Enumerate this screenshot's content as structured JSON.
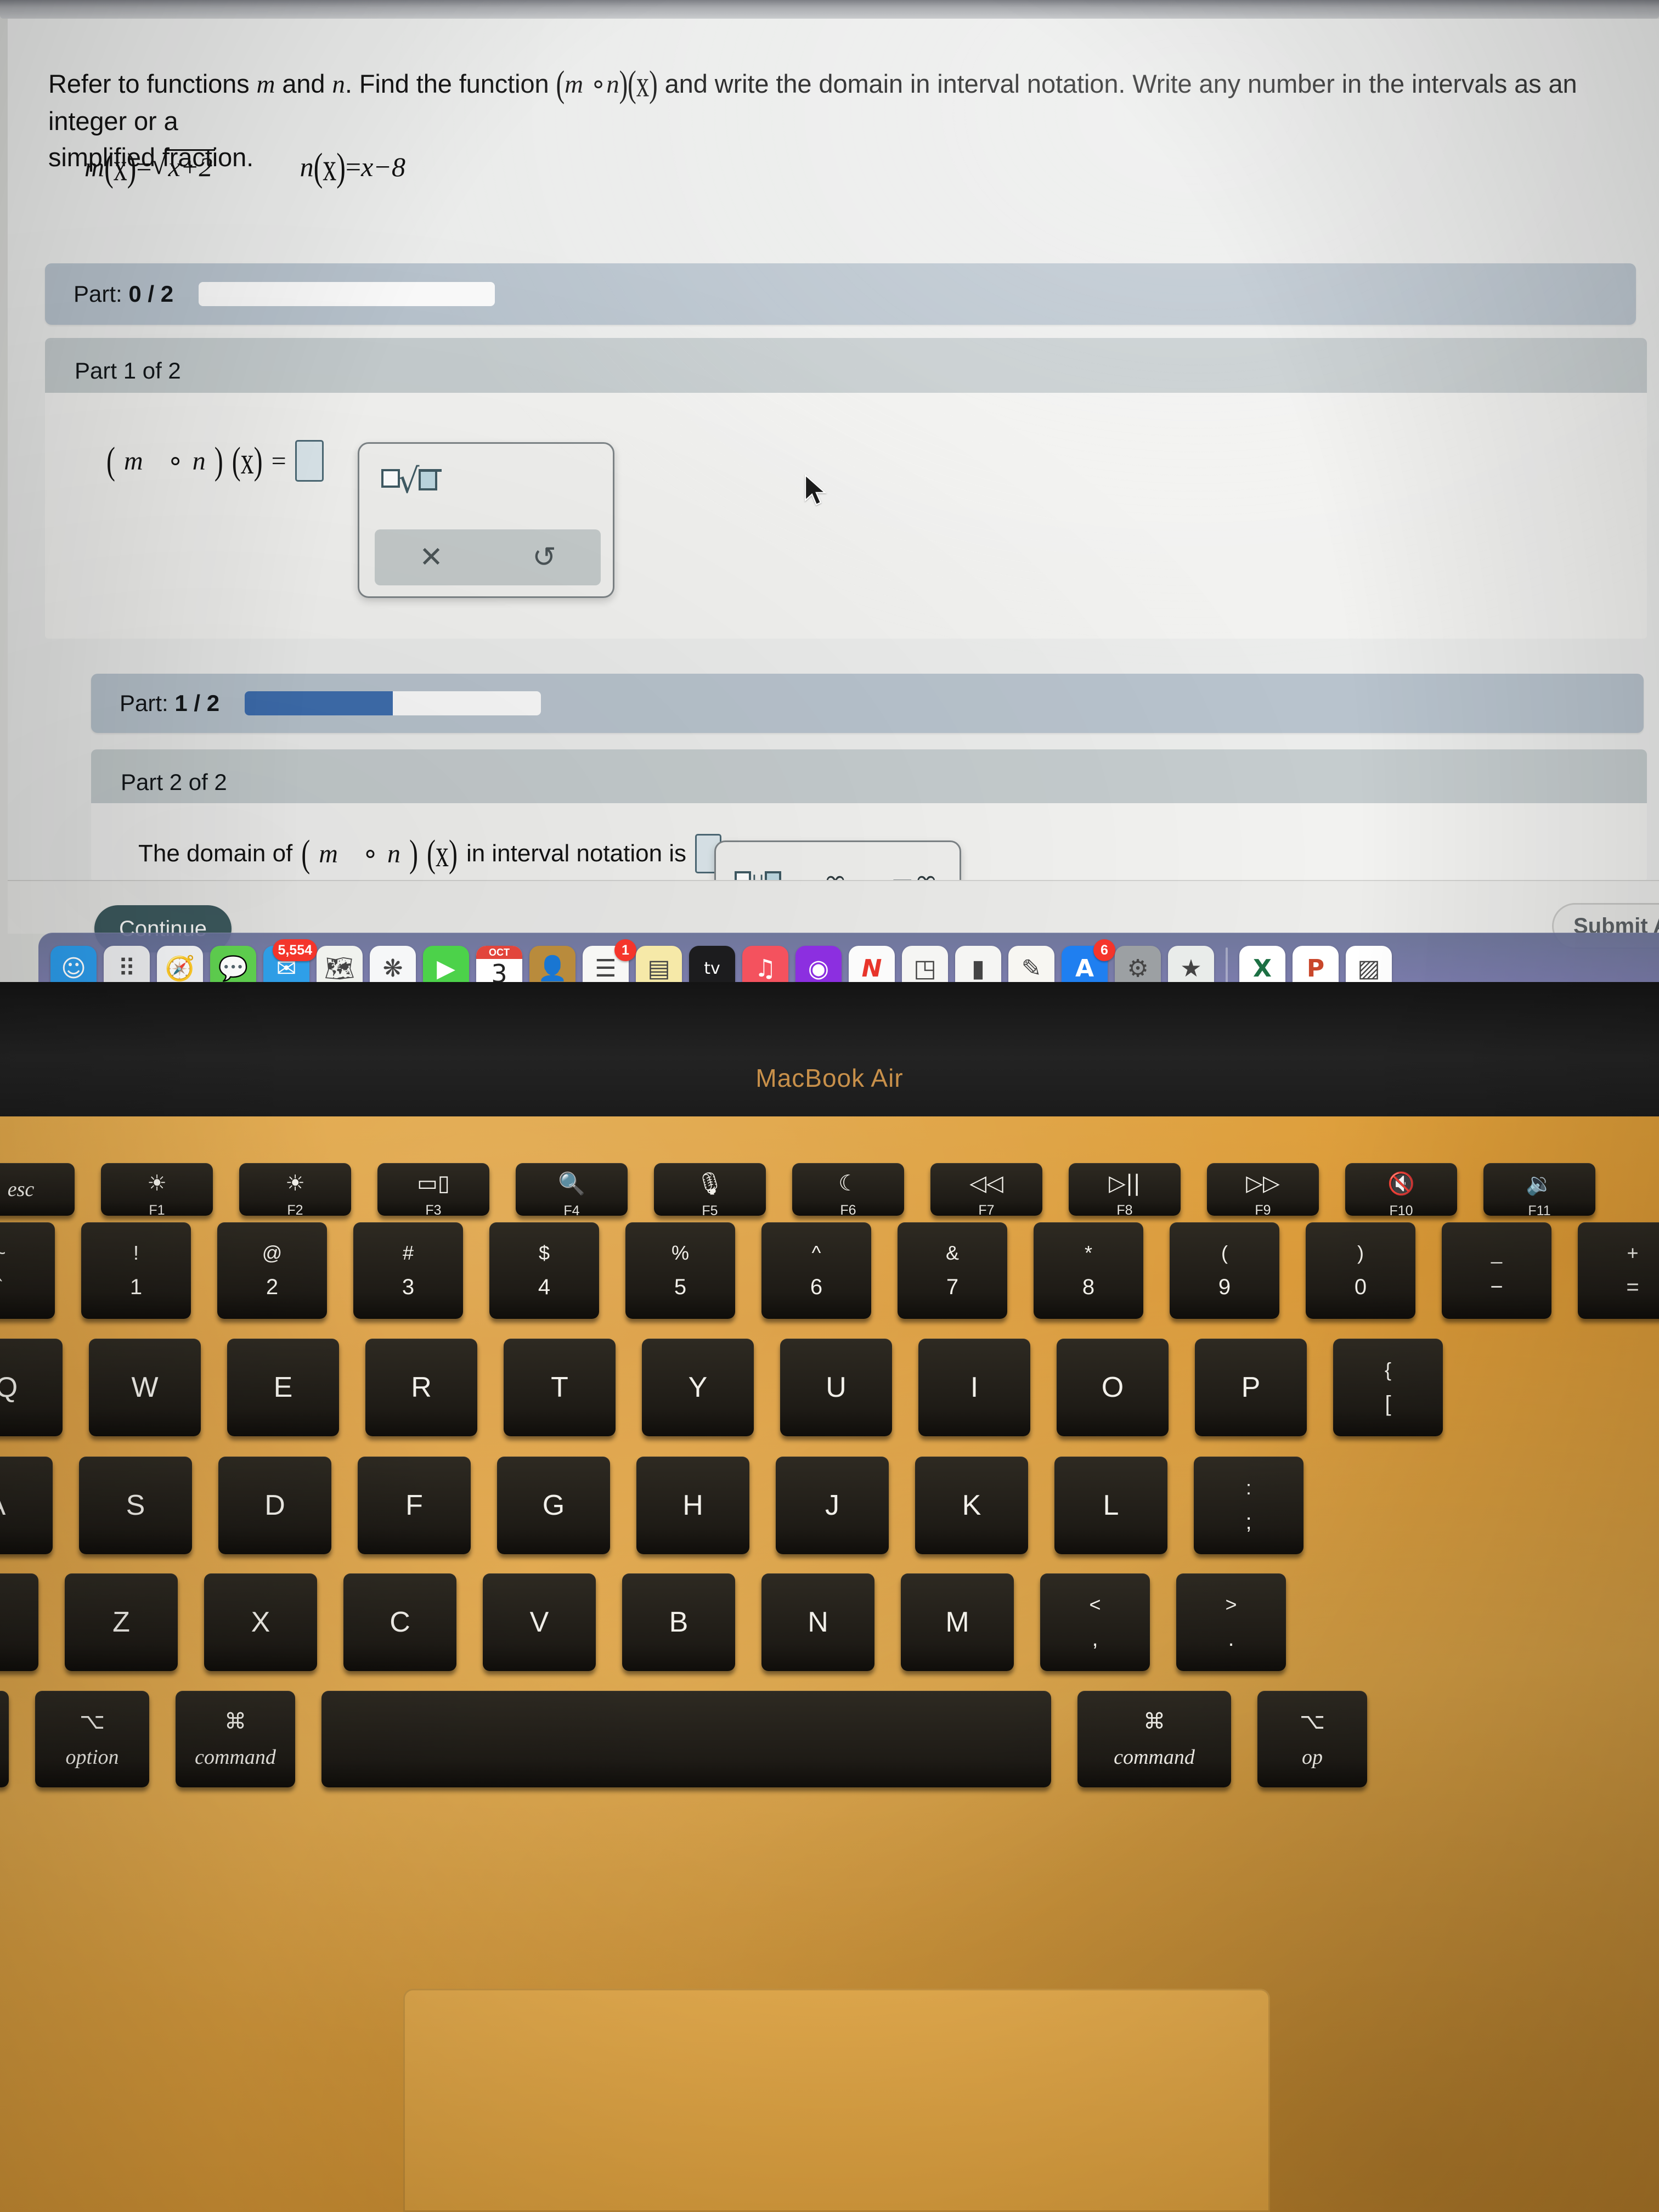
{
  "webpage": {
    "question": {
      "line1_pre": "Refer to functions ",
      "var_m": "m",
      "line1_mid": " and ",
      "var_n": "n",
      "line1_post": ". Find the function ",
      "comp_open": "(",
      "comp_m": "m",
      "comp_ring": "∘",
      "comp_n": "n",
      "comp_close": ")",
      "comp_x": "(x)",
      "line1_tail": " and write the domain in interval notation. Write any number in the intervals as an integer or a",
      "line2": "simplified fraction."
    },
    "definitions": {
      "m_label": "m",
      "m_arg": "(x)",
      "m_equals": "=",
      "m_radicand": "x+2",
      "n_label": "n",
      "n_arg": "(x)",
      "n_equals": "=",
      "n_expr": "x−8"
    },
    "part_progress_1": {
      "label": "Part:",
      "value": "0 / 2",
      "percent": 0
    },
    "part_progress_2": {
      "label": "Part:",
      "value": "1 / 2",
      "percent": 50
    },
    "part1": {
      "title": "Part 1 of 2",
      "prompt_open": "(",
      "prompt_m": "m",
      "prompt_ring": "∘",
      "prompt_n": "n",
      "prompt_close": ")",
      "prompt_x": "(x)",
      "prompt_eq": "=",
      "answer_value": ""
    },
    "part2": {
      "title": "Part 2 of 2",
      "text_pre": "The domain of ",
      "comp_open": "(",
      "comp_m": "m",
      "comp_ring": "∘",
      "comp_n": "n",
      "comp_close": ")",
      "comp_x": "(x)",
      "text_post": " in interval notation is",
      "period": ".",
      "answer_value": ""
    },
    "math_palette_1": {
      "nth_root_icon": "nth-root-icon",
      "clear_icon": "✕",
      "undo_icon": "↺"
    },
    "math_palette_2": {
      "union_icon": "□∪□",
      "infinity_icon": "∞",
      "neg_infinity_icon": "−∞"
    },
    "buttons": {
      "continue": "Continue",
      "submit": "Submit Ass"
    }
  },
  "dock": {
    "items": [
      {
        "name": "finder",
        "glyph": "☺",
        "bg": "#2b9ae8",
        "badge": null
      },
      {
        "name": "launchpad",
        "glyph": "⠿",
        "bg": "#e9eaec",
        "badge": null
      },
      {
        "name": "safari",
        "glyph": "🧭",
        "bg": "#f2f3f5",
        "badge": null
      },
      {
        "name": "messages",
        "glyph": "💬",
        "bg": "#5fd04f",
        "badge": null
      },
      {
        "name": "mail",
        "glyph": "✉",
        "bg": "#2f9fe8",
        "badge": "5,554"
      },
      {
        "name": "maps",
        "glyph": "🗺",
        "bg": "#f0f2ee",
        "badge": null
      },
      {
        "name": "photos",
        "glyph": "❋",
        "bg": "#f6f7f8",
        "badge": null
      },
      {
        "name": "facetime",
        "glyph": "▶",
        "bg": "#4cd24a",
        "badge": null
      },
      {
        "name": "calendar",
        "glyph": "3",
        "bg": "#ffffff",
        "badge": null,
        "top": "OCT"
      },
      {
        "name": "contacts",
        "glyph": "👤",
        "bg": "#b98b3c",
        "badge": null
      },
      {
        "name": "reminders",
        "glyph": "☰",
        "bg": "#f7f7f5",
        "badge": "1"
      },
      {
        "name": "notes",
        "glyph": "▤",
        "bg": "#f6e9a8",
        "badge": null
      },
      {
        "name": "apple-tv",
        "glyph": "tv",
        "bg": "#1c1c1e",
        "badge": null
      },
      {
        "name": "music",
        "glyph": "♫",
        "bg": "#f4525e",
        "badge": null
      },
      {
        "name": "podcasts",
        "glyph": "◉",
        "bg": "#8c2fe0",
        "badge": null
      },
      {
        "name": "news",
        "glyph": "N",
        "bg": "#fbfbfb",
        "badge": null
      },
      {
        "name": "keynote",
        "glyph": "◳",
        "bg": "#f5f5f3",
        "badge": null
      },
      {
        "name": "numbers",
        "glyph": "▮",
        "bg": "#f5f5f3",
        "badge": null
      },
      {
        "name": "pages",
        "glyph": "✎",
        "bg": "#f7f6f2",
        "badge": null
      },
      {
        "name": "app-store",
        "glyph": "A",
        "bg": "#1f7ff0",
        "badge": "6"
      },
      {
        "name": "system-settings",
        "glyph": "⚙",
        "bg": "#9ca0a3",
        "badge": null
      },
      {
        "name": "photo-booth",
        "glyph": "★",
        "bg": "#e9ecea",
        "badge": null
      },
      {
        "name": "separator",
        "glyph": "",
        "bg": "",
        "badge": null
      },
      {
        "name": "excel",
        "glyph": "X",
        "bg": "#ffffff",
        "badge": null
      },
      {
        "name": "powerpoint",
        "glyph": "P",
        "bg": "#ffffff",
        "badge": null
      },
      {
        "name": "finder-photo",
        "glyph": "▨",
        "bg": "#ffffff",
        "badge": null
      }
    ]
  },
  "laptop": {
    "model_name": "MacBook Air",
    "function_row": [
      {
        "label": "esc",
        "fn": "",
        "icon": ""
      },
      {
        "label": "",
        "fn": "F1",
        "icon": "brightness-low-icon",
        "glyph": "☀"
      },
      {
        "label": "",
        "fn": "F2",
        "icon": "brightness-high-icon",
        "glyph": "☀"
      },
      {
        "label": "",
        "fn": "F3",
        "icon": "mission-control-icon",
        "glyph": "▭▯"
      },
      {
        "label": "",
        "fn": "F4",
        "icon": "spotlight-search-icon",
        "glyph": "🔍"
      },
      {
        "label": "",
        "fn": "F5",
        "icon": "dictation-mic-icon",
        "glyph": "🎙"
      },
      {
        "label": "",
        "fn": "F6",
        "icon": "do-not-disturb-icon",
        "glyph": "☾"
      },
      {
        "label": "",
        "fn": "F7",
        "icon": "rewind-icon",
        "glyph": "◁◁"
      },
      {
        "label": "",
        "fn": "F8",
        "icon": "play-pause-icon",
        "glyph": "▷||"
      },
      {
        "label": "",
        "fn": "F9",
        "icon": "fast-forward-icon",
        "glyph": "▷▷"
      },
      {
        "label": "",
        "fn": "F10",
        "icon": "mute-icon",
        "glyph": "🔇"
      },
      {
        "label": "",
        "fn": "F11",
        "icon": "volume-down-icon",
        "glyph": "🔉"
      }
    ],
    "number_row": [
      {
        "top": "~",
        "bot": "`"
      },
      {
        "top": "!",
        "bot": "1"
      },
      {
        "top": "@",
        "bot": "2"
      },
      {
        "top": "#",
        "bot": "3"
      },
      {
        "top": "$",
        "bot": "4"
      },
      {
        "top": "%",
        "bot": "5"
      },
      {
        "top": "^",
        "bot": "6"
      },
      {
        "top": "&",
        "bot": "7"
      },
      {
        "top": "*",
        "bot": "8"
      },
      {
        "top": "(",
        "bot": "9"
      },
      {
        "top": ")",
        "bot": "0"
      },
      {
        "top": "_",
        "bot": "−"
      },
      {
        "top": "+",
        "bot": "="
      }
    ],
    "row_q": [
      "Q",
      "W",
      "E",
      "R",
      "T",
      "Y",
      "U",
      "I",
      "O",
      "P"
    ],
    "row_q_last": {
      "top": "{",
      "bot": "["
    },
    "row_a": [
      "A",
      "S",
      "D",
      "F",
      "G",
      "H",
      "J",
      "K",
      "L"
    ],
    "row_a_last": {
      "top": ":",
      "bot": ";"
    },
    "row_z": [
      "Z",
      "X",
      "C",
      "V",
      "B",
      "N",
      "M"
    ],
    "row_z_comma": {
      "top": "<",
      "bot": ","
    },
    "row_z_period": {
      "top": ">",
      "bot": "."
    },
    "bottom_row": {
      "control": "^",
      "option_symbol": "⌥",
      "option_label": "option",
      "command_symbol": "⌘",
      "command_label": "command",
      "command_right_symbol": "⌘",
      "command_right_label": "command",
      "option_right_symbol": "⌥",
      "option_right_label": "op"
    }
  }
}
